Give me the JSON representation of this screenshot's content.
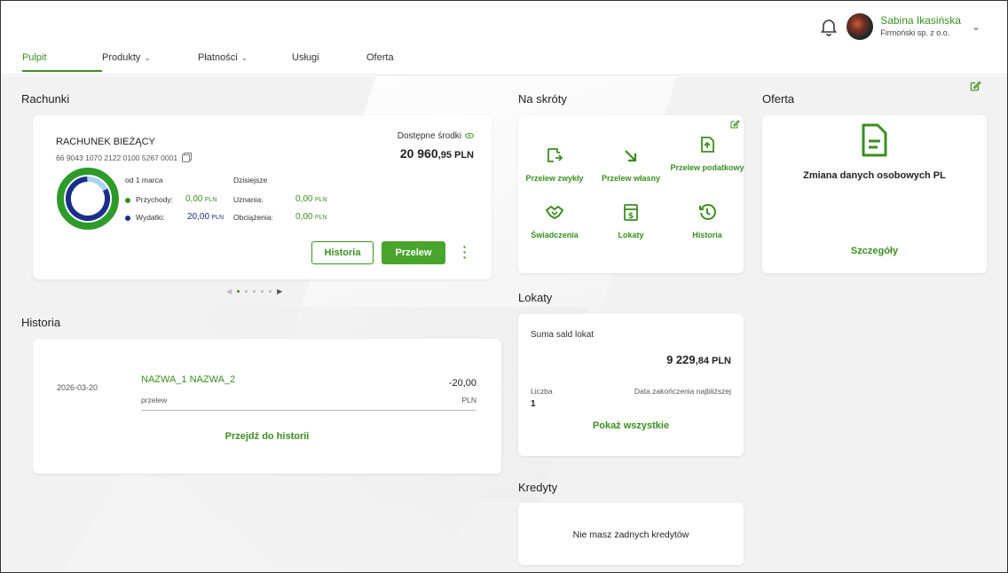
{
  "header": {
    "user_name": "Sabina Ikasińska",
    "company": "Firmoński sp. z o.o.",
    "nav": [
      {
        "label": "Pulpit"
      },
      {
        "label": "Produkty"
      },
      {
        "label": "Płatności"
      },
      {
        "label": "Usługi"
      },
      {
        "label": "Oferta"
      }
    ]
  },
  "accounts": {
    "title": "Rachunki",
    "card": {
      "name": "RACHUNEK BIEŻĄCY",
      "number": "66 9043 1070 2122 0100 5267 0001",
      "period_label": "od 1 marca",
      "today_label": "Dzisiejsze",
      "income_label": "Przychody:",
      "income_value": "0,00",
      "expense_label": "Wydatki:",
      "expense_value": "20,00",
      "credits_label": "Uznania:",
      "credits_value": "0,00",
      "debits_label": "Obciążenia:",
      "debits_value": "0,00",
      "currency": "PLN",
      "available_label": "Dostępne środki",
      "available_int": "20 960",
      "available_dec": ",95 PLN",
      "history_button": "Historia",
      "transfer_button": "Przelew"
    }
  },
  "history": {
    "title": "Historia",
    "item": {
      "date": "2026-03-20",
      "name": "NAZWA_1 NAZWA_2",
      "type": "przelew",
      "amount": "-20,00",
      "currency": "PLN"
    },
    "link": "Przejdź do historii"
  },
  "shortcuts": {
    "title": "Na skróty",
    "items": [
      {
        "label": "Przelew zwykły"
      },
      {
        "label": "Przelew własny"
      },
      {
        "label": "Przelew podatkowy"
      },
      {
        "label": "Świadczenia"
      },
      {
        "label": "Lokaty"
      },
      {
        "label": "Historia"
      }
    ]
  },
  "deposits": {
    "title": "Lokaty",
    "sum_label": "Suma sald lokat",
    "sum_int": "9 229",
    "sum_dec": ",84 PLN",
    "count_label": "Liczba",
    "count_value": "1",
    "date_label": "Data zakończenia najbliższej",
    "link": "Pokaż wszystkie"
  },
  "credits": {
    "title": "Kredyty",
    "empty": "Nie masz żadnych kredytów"
  },
  "offer": {
    "title": "Oferta",
    "item_title": "Zmiana danych osobowych PL",
    "link": "Szczegóły"
  },
  "colors": {
    "accent": "#3a8f1f",
    "expense": "#1a2f8a",
    "income": "#2e9a2a"
  },
  "chart_data": {
    "type": "pie",
    "categories": [
      "Przychody",
      "Wydatki"
    ],
    "values": [
      0,
      20
    ]
  }
}
